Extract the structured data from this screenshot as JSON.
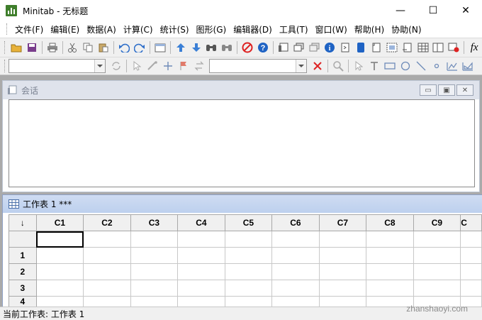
{
  "window": {
    "title": "Minitab - 无标题",
    "minimize": "—",
    "maximize": "☐",
    "close": "✕"
  },
  "menu": [
    "文件(F)",
    "编辑(E)",
    "数据(A)",
    "计算(C)",
    "统计(S)",
    "图形(G)",
    "编辑器(D)",
    "工具(T)",
    "窗口(W)",
    "帮助(H)",
    "协助(N)"
  ],
  "toolbar": {
    "fx_label": "fx"
  },
  "session": {
    "title": "会话"
  },
  "worksheet": {
    "title": "工作表 1 ***",
    "corner": "↓",
    "columns": [
      "C1",
      "C2",
      "C3",
      "C4",
      "C5",
      "C6",
      "C7",
      "C8",
      "C9",
      "C"
    ],
    "rows": [
      "1",
      "2",
      "3",
      "4"
    ]
  },
  "status": {
    "text": "当前工作表: 工作表 1"
  },
  "watermark": "zhanshaoyi.com",
  "colors": {
    "accent": "#3f7e2b",
    "worksheet_title": "#c4d5ef",
    "mdi_background": "#aaaaaa"
  }
}
